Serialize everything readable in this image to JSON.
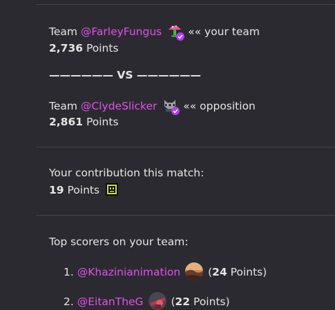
{
  "teams": {
    "yours": {
      "prefix": "Team ",
      "handle": "@FarleyFungus",
      "suffix": "«« your team",
      "points": "2,736",
      "points_label": "Points",
      "avatar_icon": "mushroom-icon"
    },
    "vs_text": "——————  VS  ——————",
    "opponent": {
      "prefix": "Team ",
      "handle": "@ClydeSlicker",
      "suffix": "«« opposition",
      "points": "2,861",
      "points_label": "Points",
      "avatar_icon": "raccoon-icon"
    }
  },
  "contribution": {
    "heading": "Your contribution this match:",
    "points": "19",
    "points_label": "Points",
    "emoji_icon": "pixel-face-icon"
  },
  "top_scorers": {
    "heading": "Top scorers on your team:",
    "list": [
      {
        "rank": "1.",
        "handle": "@Khazinianimation",
        "points": "24",
        "points_label": "Points",
        "avatar_icon": "landscape-avatar"
      },
      {
        "rank": "2.",
        "handle": "@EitanTheG",
        "points": "22",
        "points_label": "Points",
        "avatar_icon": "red-character-avatar"
      }
    ]
  },
  "colors": {
    "background": "#2b2a30",
    "mention": "#e64ff0",
    "divider": "#45434b",
    "verified_badge": "#b13df5"
  }
}
